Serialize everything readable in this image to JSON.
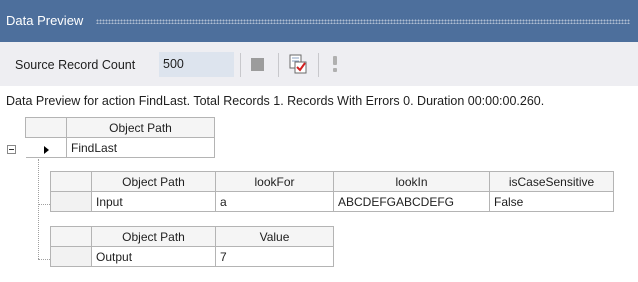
{
  "window": {
    "title": "Data Preview"
  },
  "toolbar": {
    "source_count_label": "Source Record Count",
    "source_count_value": "500",
    "stop_icon": "stop-icon",
    "check_icon": "document-check-icon",
    "light_icon": "exclamation-icon"
  },
  "summary": "Data Preview for action FindLast. Total Records 1. Records With Errors 0. Duration 00:00:00.260.",
  "root_grid": {
    "header": "Object Path",
    "row": "FindLast"
  },
  "input_grid": {
    "headers": [
      "Object Path",
      "lookFor",
      "lookIn",
      "isCaseSensitive"
    ],
    "row": [
      "Input",
      "a",
      "ABCDEFGABCDEFG",
      "False"
    ]
  },
  "output_grid": {
    "headers": [
      "Object Path",
      "Value"
    ],
    "row": [
      "Output",
      "7"
    ]
  },
  "colors": {
    "titlebar": "#4d6f9c",
    "toolbar": "#eeeef2",
    "count_box": "#dde4ee"
  }
}
